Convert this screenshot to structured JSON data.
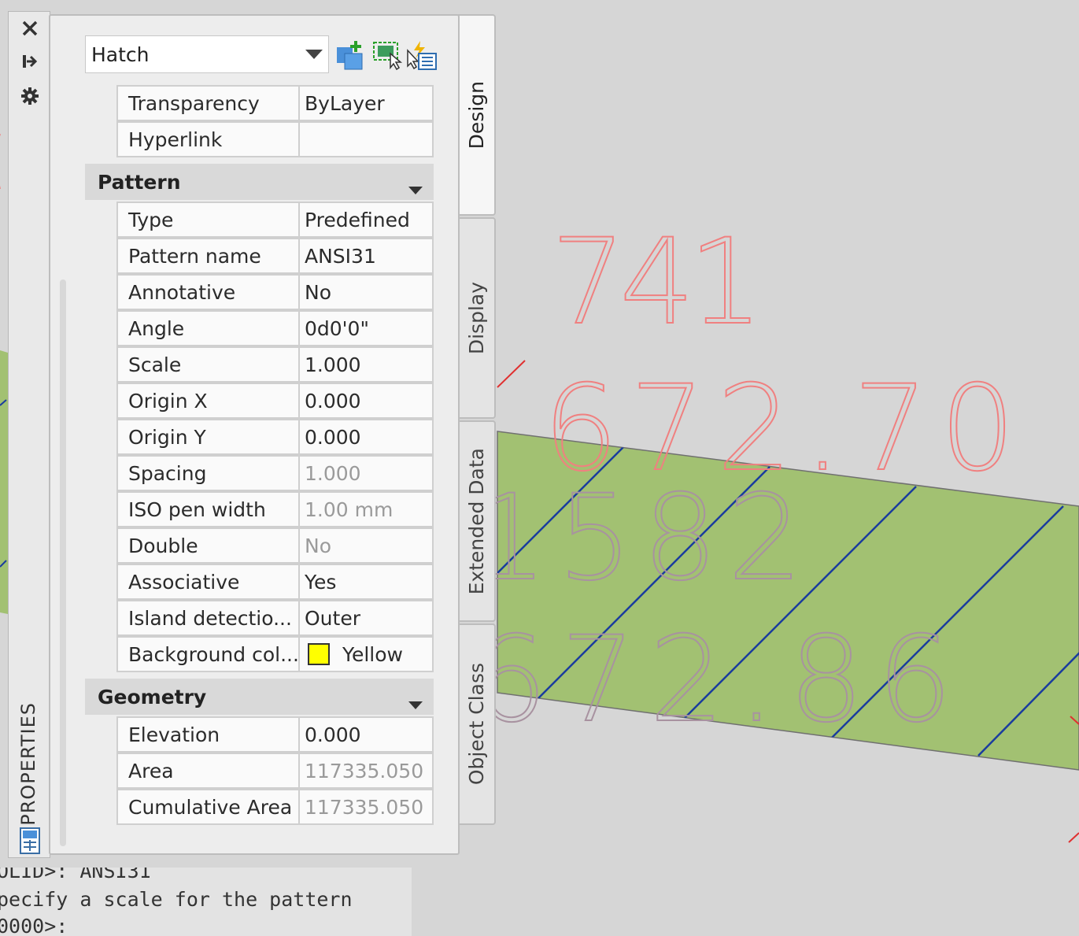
{
  "drawing": {
    "texts": [
      {
        "text": "741"
      },
      {
        "text": "672.70"
      },
      {
        "text": "1582"
      },
      {
        "text": "672.86"
      }
    ],
    "hatch_fill_color": "#a2c172",
    "hatch_line_color": "#1a3c9e",
    "annotation_color": "#f08080",
    "gray_text_color": "#a892a0"
  },
  "strip": {
    "title": "PROPERTIES",
    "icons": [
      "close-icon",
      "auto-hide-icon",
      "settings-icon",
      "properties-palette-icon"
    ]
  },
  "header": {
    "object_type": "Hatch",
    "tool_icons": [
      "toggle-pickadd-icon",
      "select-objects-icon",
      "quick-select-icon"
    ]
  },
  "general_rows": [
    {
      "key": "Transparency",
      "value": "ByLayer",
      "muted": false
    },
    {
      "key": "Hyperlink",
      "value": "",
      "muted": false
    }
  ],
  "pattern": {
    "title": "Pattern",
    "rows": [
      {
        "key": "Type",
        "value": "Predefined",
        "muted": false
      },
      {
        "key": "Pattern name",
        "value": "ANSI31",
        "muted": false
      },
      {
        "key": "Annotative",
        "value": "No",
        "muted": false
      },
      {
        "key": "Angle",
        "value": "0d0'0\"",
        "muted": false
      },
      {
        "key": "Scale",
        "value": "1.000",
        "muted": false
      },
      {
        "key": "Origin X",
        "value": "0.000",
        "muted": false
      },
      {
        "key": "Origin Y",
        "value": "0.000",
        "muted": false
      },
      {
        "key": "Spacing",
        "value": "1.000",
        "muted": true
      },
      {
        "key": "ISO pen width",
        "value": "1.00 mm",
        "muted": true
      },
      {
        "key": "Double",
        "value": "No",
        "muted": true
      },
      {
        "key": "Associative",
        "value": "Yes",
        "muted": false
      },
      {
        "key": "Island  detectio...",
        "value": "Outer",
        "muted": false
      },
      {
        "key": "Background  col...",
        "value": "Yellow",
        "muted": false,
        "swatch": "#ffff00"
      }
    ]
  },
  "geometry": {
    "title": "Geometry",
    "rows": [
      {
        "key": "Elevation",
        "value": "0.000",
        "muted": false
      },
      {
        "key": "Area",
        "value": "117335.050",
        "muted": true
      },
      {
        "key": "Cumulative Area",
        "value": "117335.050",
        "muted": true
      }
    ]
  },
  "tabs": [
    {
      "label": "Design",
      "active": true
    },
    {
      "label": "Display",
      "active": false
    },
    {
      "label": "Extended Data",
      "active": false
    },
    {
      "label": "Object Class",
      "active": false
    }
  ],
  "command_line": [
    "OLID>: ANSI31",
    "pecify a scale for the pattern",
    "0000>:"
  ]
}
